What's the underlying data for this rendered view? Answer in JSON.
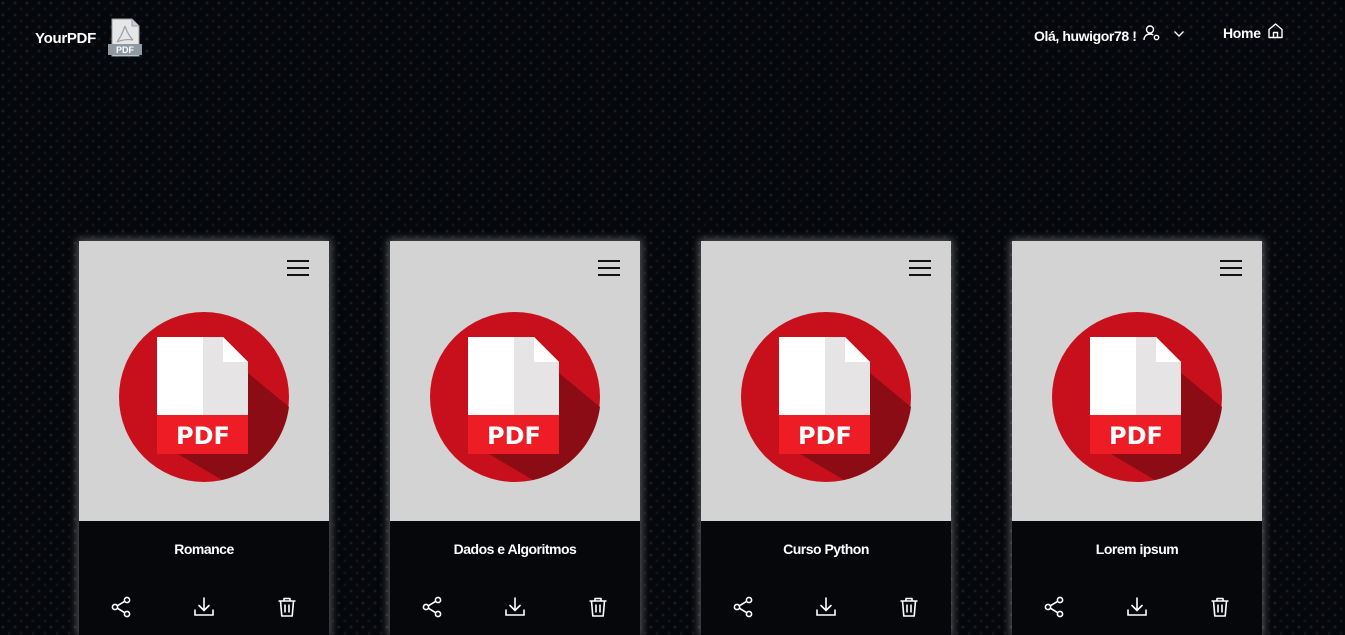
{
  "header": {
    "brand_name": "YourPDF",
    "brand_logo_icon": "pdf-file-icon",
    "brand_logo_text": "PDF",
    "greeting": "Olá, huwigor78 !",
    "user_icon": "user-settings-icon",
    "dropdown_icon": "chevron-down-icon",
    "home_label": "Home",
    "home_icon": "home-icon"
  },
  "cards": [
    {
      "title": "Romance",
      "icon_label": "PDF"
    },
    {
      "title": "Dados e Algoritmos",
      "icon_label": "PDF"
    },
    {
      "title": "Curso Python",
      "icon_label": "PDF"
    },
    {
      "title": "Lorem ipsum",
      "icon_label": "PDF"
    }
  ],
  "card_actions": [
    "share-icon",
    "download-icon",
    "trash-icon"
  ],
  "colors": {
    "background": "#05070b",
    "card_top": "#d3d3d3",
    "pdf_red": "#c8101c",
    "pdf_dark_red": "#8b0c14",
    "text": "#ffffff"
  }
}
